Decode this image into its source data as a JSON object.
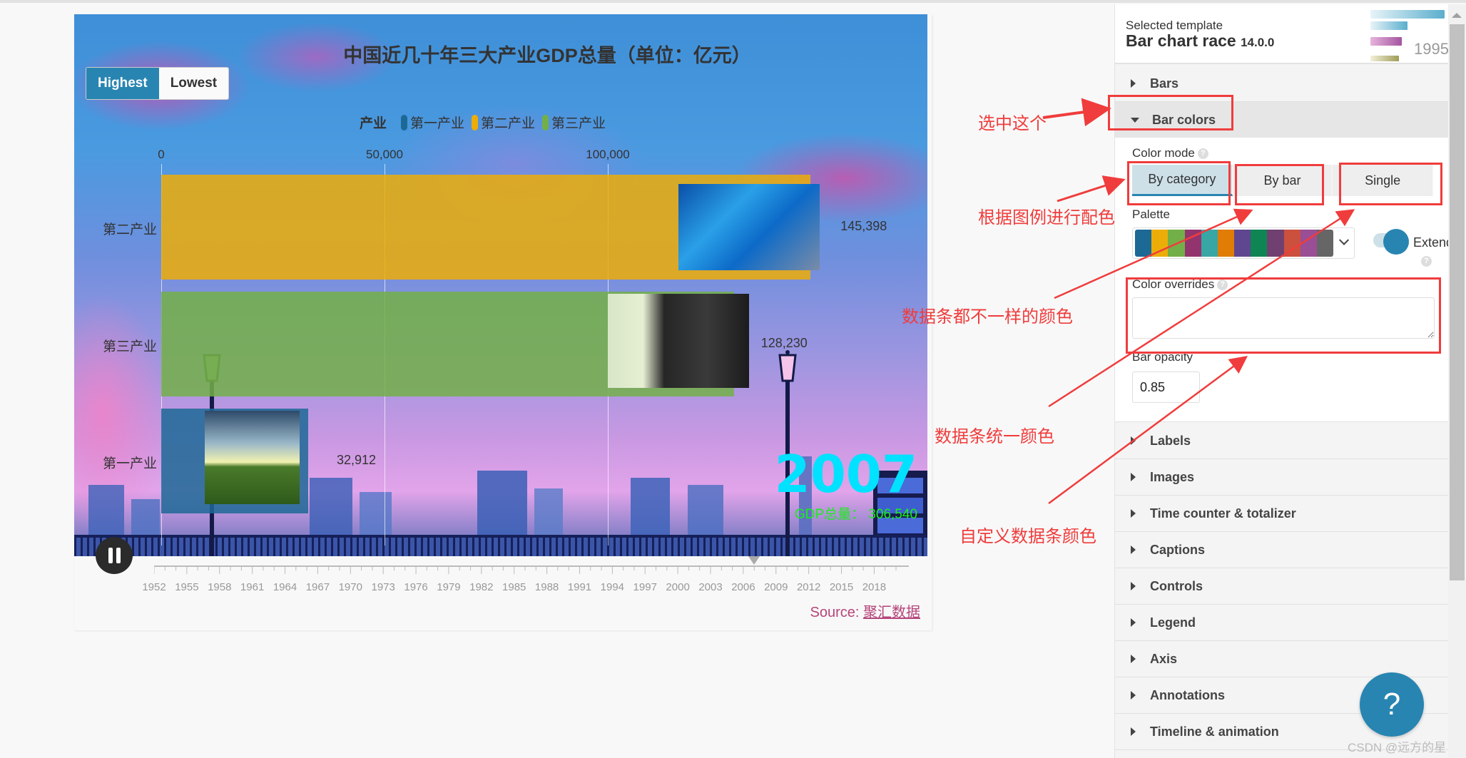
{
  "chart": {
    "title": "中国近几十年三大产业GDP总量（单位：亿元）",
    "sort_buttons": {
      "highest": "Highest",
      "lowest": "Lowest",
      "selected": "Highest"
    },
    "legend": {
      "title": "产业",
      "items": [
        {
          "label": "第一产业",
          "color": "#1d6996"
        },
        {
          "label": "第二产业",
          "color": "#edad08"
        },
        {
          "label": "第三产业",
          "color": "#73af48"
        }
      ]
    },
    "axis_ticks": [
      "0",
      "50,000",
      "100,000"
    ],
    "bars": [
      {
        "label": "第二产业",
        "value_text": "145,398",
        "image": "technology-photo"
      },
      {
        "label": "第三产业",
        "value_text": "128,230",
        "image": "business-people-photo"
      },
      {
        "label": "第一产业",
        "value_text": "32,912",
        "image": "farm-field-photo"
      }
    ],
    "time_counter": "2007",
    "totalizer": "GDP总量： 306,540",
    "timeline": {
      "labels": [
        "1952",
        "1955",
        "1958",
        "1961",
        "1964",
        "1967",
        "1970",
        "1973",
        "1976",
        "1979",
        "1982",
        "1985",
        "1988",
        "1991",
        "1994",
        "1997",
        "2000",
        "2003",
        "2006",
        "2009",
        "2012",
        "2015",
        "2018"
      ],
      "current": "2007"
    },
    "source": {
      "prefix": "Source: ",
      "link_text": "聚汇数据"
    }
  },
  "chart_data": {
    "type": "bar",
    "orientation": "horizontal",
    "title": "中国近几十年三大产业GDP总量（单位：亿元）",
    "legend_title": "产业",
    "legend_placement": "top",
    "categories": [
      "第二产业",
      "第三产业",
      "第一产业"
    ],
    "values": [
      145398,
      128230,
      32912
    ],
    "colors": [
      "#edad08",
      "#73af48",
      "#1d6996"
    ],
    "xlim": [
      0,
      160000
    ],
    "x_ticks": [
      0,
      50000,
      100000
    ],
    "xlabel": "",
    "ylabel": "",
    "grid": true,
    "current_year": 2007,
    "total": 306540
  },
  "panel": {
    "template_caption": "Selected template",
    "template_name": "Bar chart race",
    "template_version": "14.0.0",
    "thumb_year": "1995",
    "sections_before": [
      {
        "label": "Bars"
      }
    ],
    "open_section": {
      "label": "Bar colors"
    },
    "bar_colors": {
      "color_mode_label": "Color mode",
      "modes": [
        {
          "label": "By category",
          "active": true
        },
        {
          "label": "By bar",
          "active": false
        },
        {
          "label": "Single",
          "active": false
        }
      ],
      "palette_label": "Palette",
      "palette_colors": [
        "#1d6996",
        "#edad08",
        "#73af48",
        "#94346e",
        "#38a6a5",
        "#e17c05",
        "#5f4690",
        "#0f8554",
        "#6f4070",
        "#cc503e",
        "#994e95",
        "#666666"
      ],
      "extend_label": "Extend",
      "extend_on": true,
      "color_overrides_label": "Color overrides",
      "color_overrides_value": "",
      "bar_opacity_label": "Bar opacity",
      "bar_opacity_value": "0.85"
    },
    "sections_after": [
      {
        "label": "Labels"
      },
      {
        "label": "Images"
      },
      {
        "label": "Time counter & totalizer"
      },
      {
        "label": "Captions"
      },
      {
        "label": "Controls"
      },
      {
        "label": "Legend"
      },
      {
        "label": "Axis"
      },
      {
        "label": "Annotations"
      },
      {
        "label": "Timeline & animation"
      }
    ],
    "help_button": "?"
  },
  "annotations": [
    {
      "text": "选中这个"
    },
    {
      "text": "根据图例进行配色"
    },
    {
      "text": "数据条都不一样的颜色"
    },
    {
      "text": "数据条统一颜色"
    },
    {
      "text": "自定义数据条颜色"
    }
  ],
  "watermark": "CSDN @远方的星",
  "colors": {
    "accent": "#2885b2",
    "annotation": "#f03c3c",
    "counter": "#00e2ff",
    "totalizer": "#18f018"
  }
}
